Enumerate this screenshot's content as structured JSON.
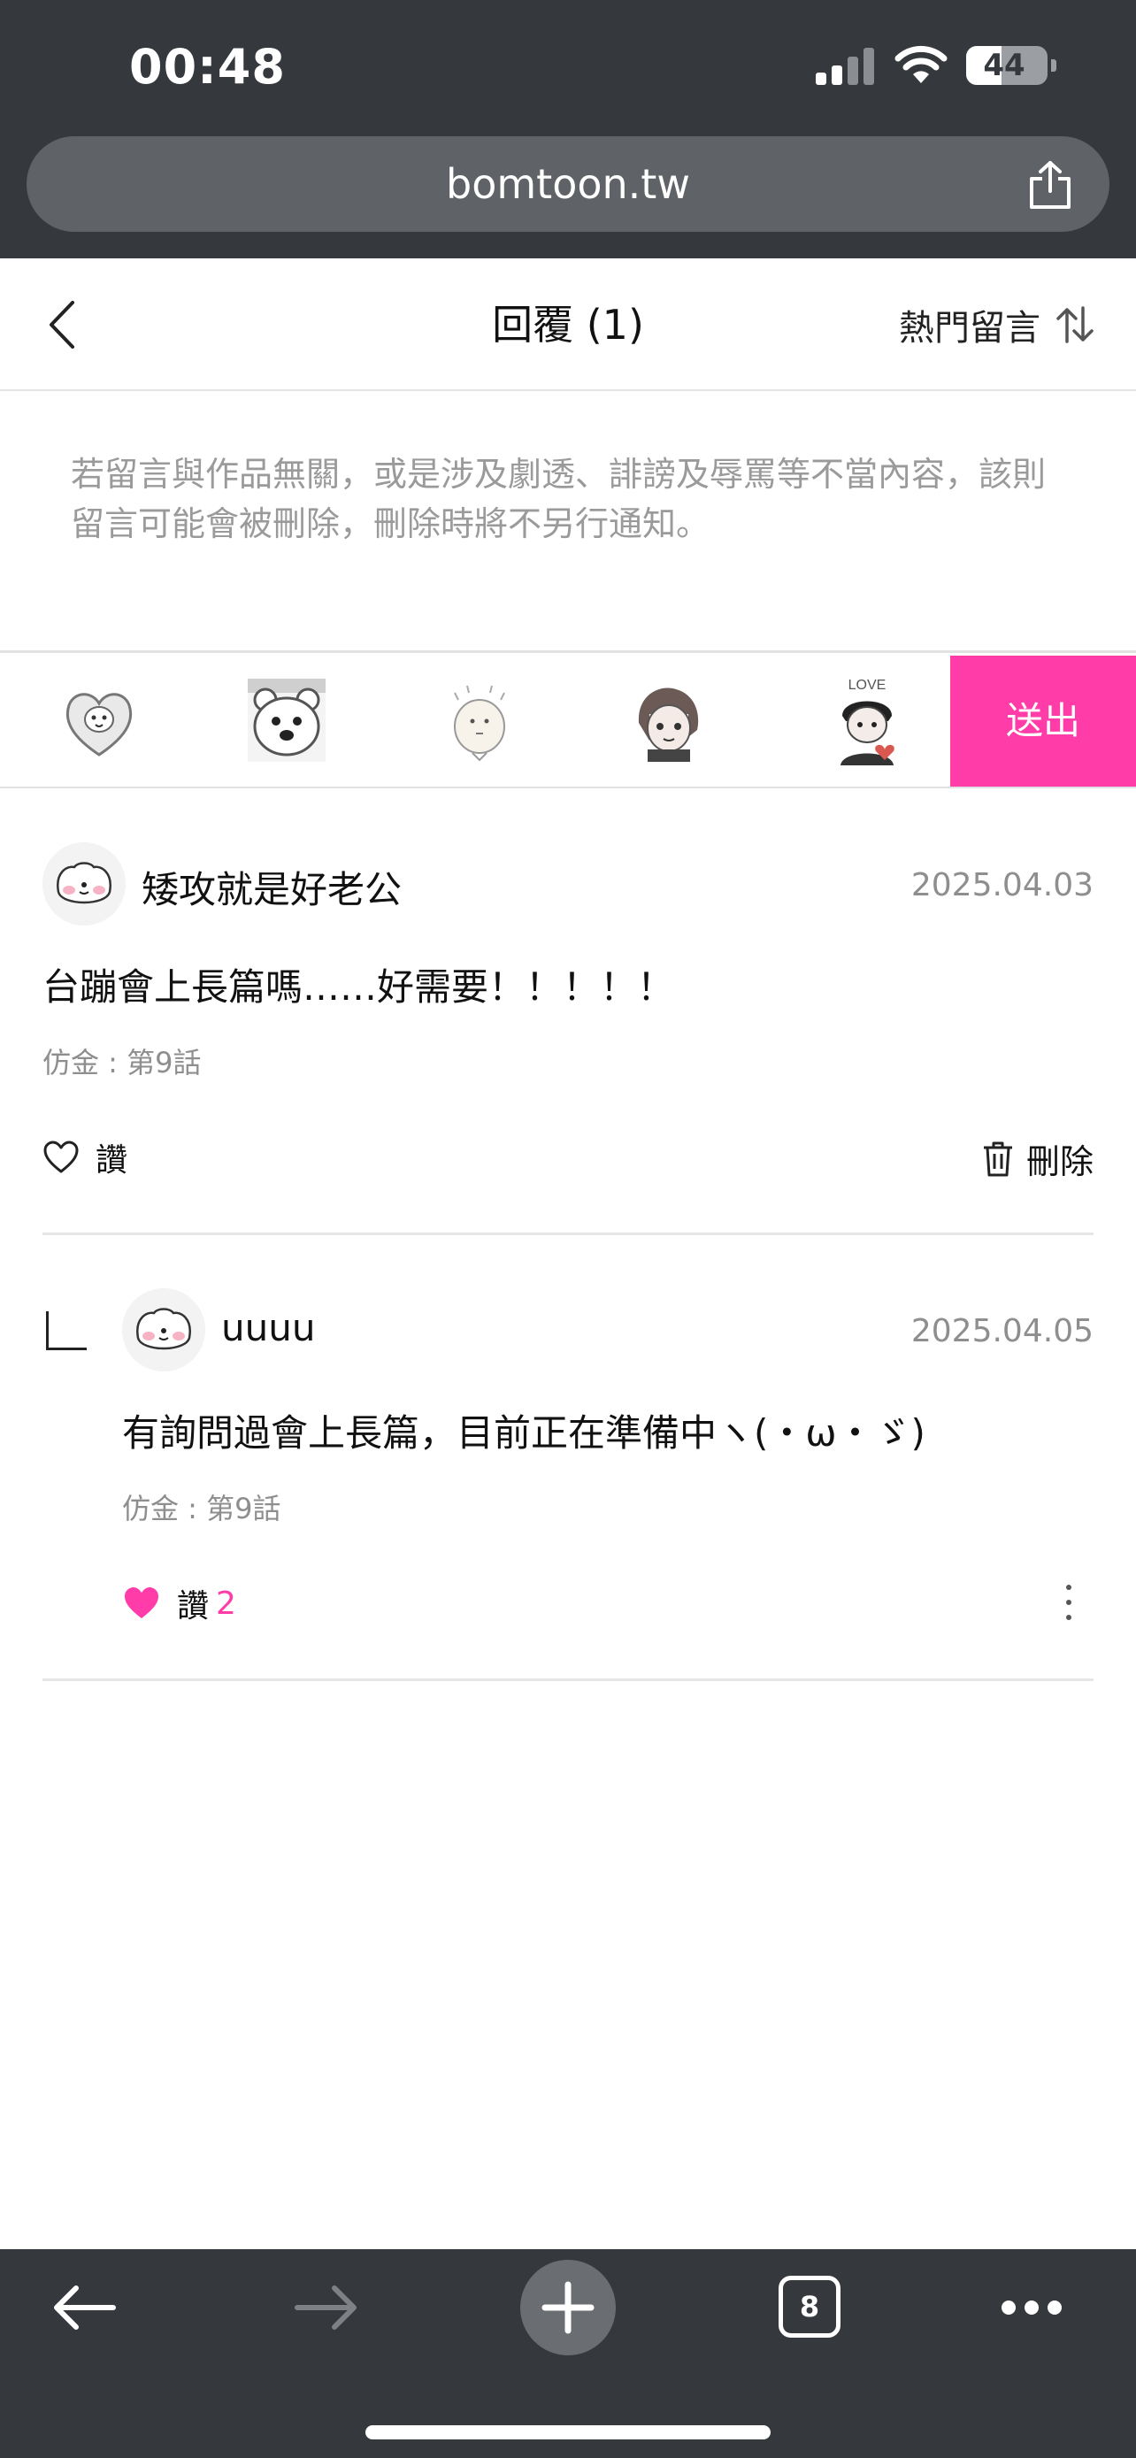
{
  "status_bar": {
    "time": "00:48",
    "battery": "44"
  },
  "browser": {
    "url": "bomtoon.tw",
    "tab_count": "8"
  },
  "header": {
    "title": "回覆 (1)",
    "sort_label": "熱門留言"
  },
  "notice": {
    "text": "若留言與作品無關，或是涉及劇透、誹謗及辱罵等不當內容，該則留言可能會被刪除，刪除時將不另行通知。"
  },
  "sticker_bar": {
    "stickers": [
      "heart-bunny-sticker",
      "bear-sticker",
      "sweat-character-sticker",
      "girl-face-sticker",
      "love-boy-sticker"
    ],
    "send_label": "送出"
  },
  "comment": {
    "author": "矮攻就是好老公",
    "date": "2025.04.03",
    "text": "台蹦會上長篇嗎……好需要！！！！！",
    "episode": "仿金 : 第9話",
    "like_label": "讚",
    "delete_label": "刪除"
  },
  "reply": {
    "author": "uuuu",
    "date": "2025.04.05",
    "text": "有詢問過會上長篇，目前正在準備中ヽ(・ω・ゞ)",
    "episode": "仿金 : 第9話",
    "like_label": "讚",
    "like_count": "2"
  },
  "colors": {
    "accent": "#ff3ca8",
    "chrome": "#35383c"
  }
}
